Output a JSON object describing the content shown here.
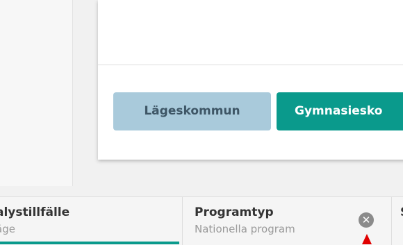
{
  "buttons": {
    "kommun_label": "Lägeskommun",
    "gymnasie_label": "Gymnasiesko"
  },
  "filters": [
    {
      "title": "alystillfälle",
      "value": "äge"
    },
    {
      "title": "Programtyp",
      "value": "Nationella program"
    },
    {
      "title": "S",
      "value": ""
    }
  ],
  "icons": {
    "clear": "close-circle-icon",
    "pointer": "pointer-arrow-icon"
  },
  "colors": {
    "teal": "#0a9a8c",
    "light_blue": "#a9cadb",
    "pointer": "#e00000"
  }
}
